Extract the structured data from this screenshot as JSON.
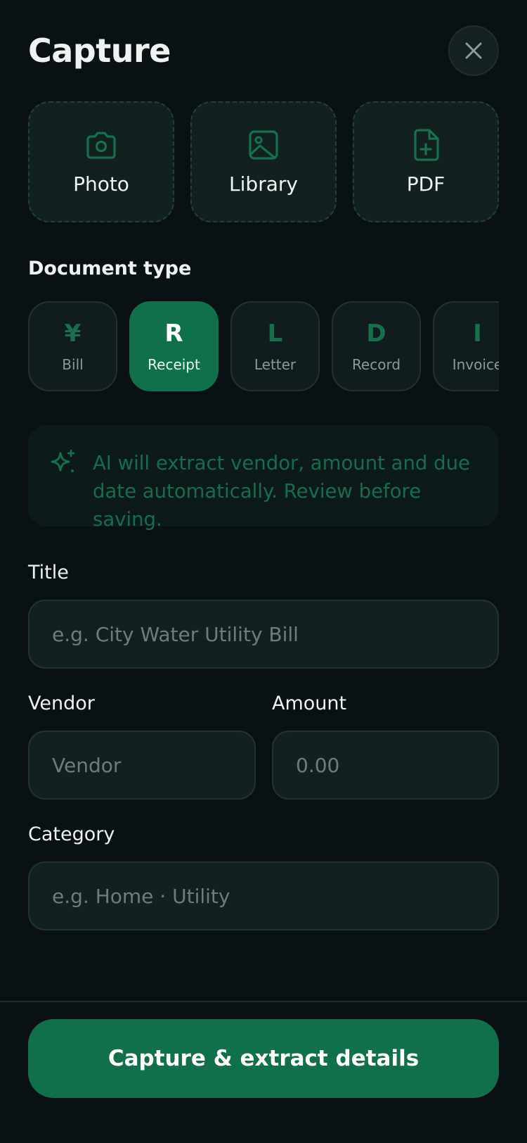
{
  "header": {
    "title": "Capture"
  },
  "sources": [
    {
      "label": "Photo",
      "icon": "camera-icon"
    },
    {
      "label": "Library",
      "icon": "image-icon"
    },
    {
      "label": "PDF",
      "icon": "file-plus-icon"
    }
  ],
  "document_type": {
    "title": "Document type",
    "selected": "Receipt",
    "options": [
      {
        "glyph": "¥",
        "label": "Bill"
      },
      {
        "glyph": "R",
        "label": "Receipt"
      },
      {
        "glyph": "L",
        "label": "Letter"
      },
      {
        "glyph": "D",
        "label": "Record"
      },
      {
        "glyph": "I",
        "label": "Invoice"
      }
    ]
  },
  "ai_note": {
    "icon": "sparkle-icon",
    "text": "AI will extract vendor, amount and due date automatically. Review before saving."
  },
  "form": {
    "title": {
      "label": "Title",
      "value": "",
      "placeholder": "e.g. City Water Utility Bill"
    },
    "vendor": {
      "label": "Vendor",
      "value": "",
      "placeholder": "Vendor"
    },
    "amount": {
      "label": "Amount",
      "value": "",
      "placeholder": "0.00"
    },
    "category": {
      "label": "Category",
      "value": "",
      "placeholder": "e.g. Home · Utility"
    }
  },
  "cta": {
    "label": "Capture & extract details"
  },
  "colors": {
    "background": "#091114",
    "accent": "#10704c",
    "accent_text": "#1a6b4e",
    "surface": "#122022"
  }
}
